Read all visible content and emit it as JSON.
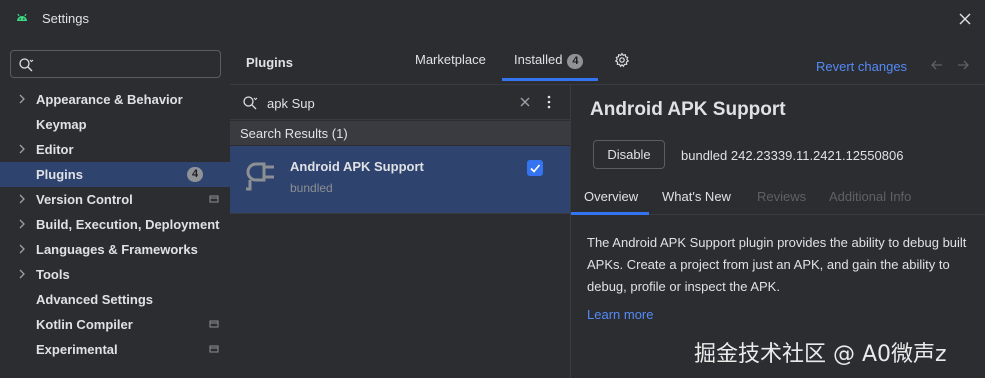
{
  "window": {
    "title": "Settings",
    "close_icon": "close-icon"
  },
  "sidebar": {
    "search_placeholder": "",
    "items": [
      {
        "label": "Appearance & Behavior",
        "expandable": true
      },
      {
        "label": "Keymap",
        "expandable": false
      },
      {
        "label": "Editor",
        "expandable": true
      },
      {
        "label": "Plugins",
        "expandable": false,
        "selected": true,
        "badge": "4"
      },
      {
        "label": "Version Control",
        "expandable": true,
        "project_icon": true
      },
      {
        "label": "Build, Execution, Deployment",
        "expandable": true
      },
      {
        "label": "Languages & Frameworks",
        "expandable": true
      },
      {
        "label": "Tools",
        "expandable": true
      },
      {
        "label": "Advanced Settings",
        "expandable": false
      },
      {
        "label": "Kotlin Compiler",
        "expandable": false,
        "project_icon": true
      },
      {
        "label": "Experimental",
        "expandable": false,
        "project_icon": true
      }
    ]
  },
  "plugins": {
    "header": "Plugins",
    "tabs": [
      {
        "label": "Marketplace"
      },
      {
        "label": "Installed",
        "count": "4",
        "active": true
      }
    ],
    "revert_label": "Revert changes",
    "search_value": "apk Sup",
    "results_header": "Search Results (1)",
    "result": {
      "name": "Android APK Support",
      "status": "bundled",
      "enabled": true
    }
  },
  "detail": {
    "title": "Android APK Support",
    "disable_label": "Disable",
    "version": "bundled 242.23339.11.2421.12550806",
    "tabs": [
      {
        "label": "Overview",
        "active": true
      },
      {
        "label": "What's New",
        "active": true
      },
      {
        "label": "Reviews",
        "active": false
      },
      {
        "label": "Additional Info",
        "active": false
      }
    ],
    "description": "The Android APK Support plugin provides the ability to debug built APKs. Create a project from just an APK, and gain the ability to debug, profile or inspect the APK.",
    "learn_more": "Learn more"
  },
  "watermark": "掘金技术社区 @ A0微声z",
  "colors": {
    "accent": "#3574f0",
    "selection": "#2e436e",
    "link": "#548af7",
    "bg": "#2b2d30"
  }
}
